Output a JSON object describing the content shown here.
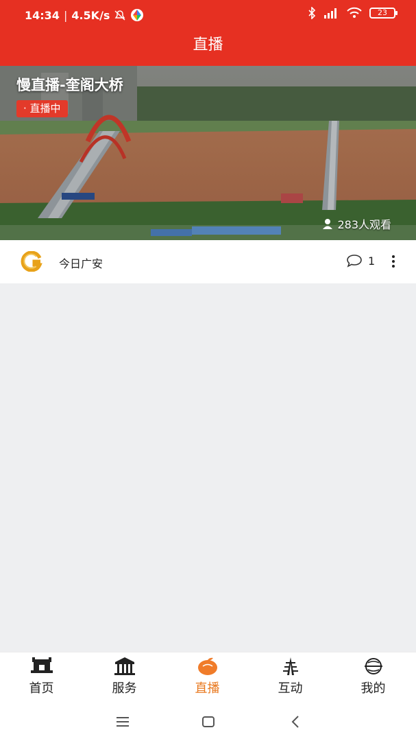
{
  "status_bar": {
    "time": "14:34",
    "speed": "4.5K/s",
    "battery": "23",
    "icons": [
      "mute-icon",
      "app-icon",
      "bluetooth-icon",
      "signal-icon",
      "wifi-icon",
      "battery-icon"
    ]
  },
  "header": {
    "title": "直播"
  },
  "live_card": {
    "title": "慢直播-奎阁大桥",
    "badge": "· 直播中",
    "viewers": "283人观看"
  },
  "meta": {
    "source": "今日广安",
    "comments": "1"
  },
  "tabbar": {
    "items": [
      {
        "label": "首页",
        "icon": "home-icon"
      },
      {
        "label": "服务",
        "icon": "service-icon"
      },
      {
        "label": "直播",
        "icon": "live-icon",
        "active": true
      },
      {
        "label": "互动",
        "icon": "interact-icon"
      },
      {
        "label": "我的",
        "icon": "profile-icon"
      }
    ]
  },
  "colors": {
    "brand_red": "#e63022",
    "active_orange": "#e8781e",
    "background": "#eeeff1"
  }
}
